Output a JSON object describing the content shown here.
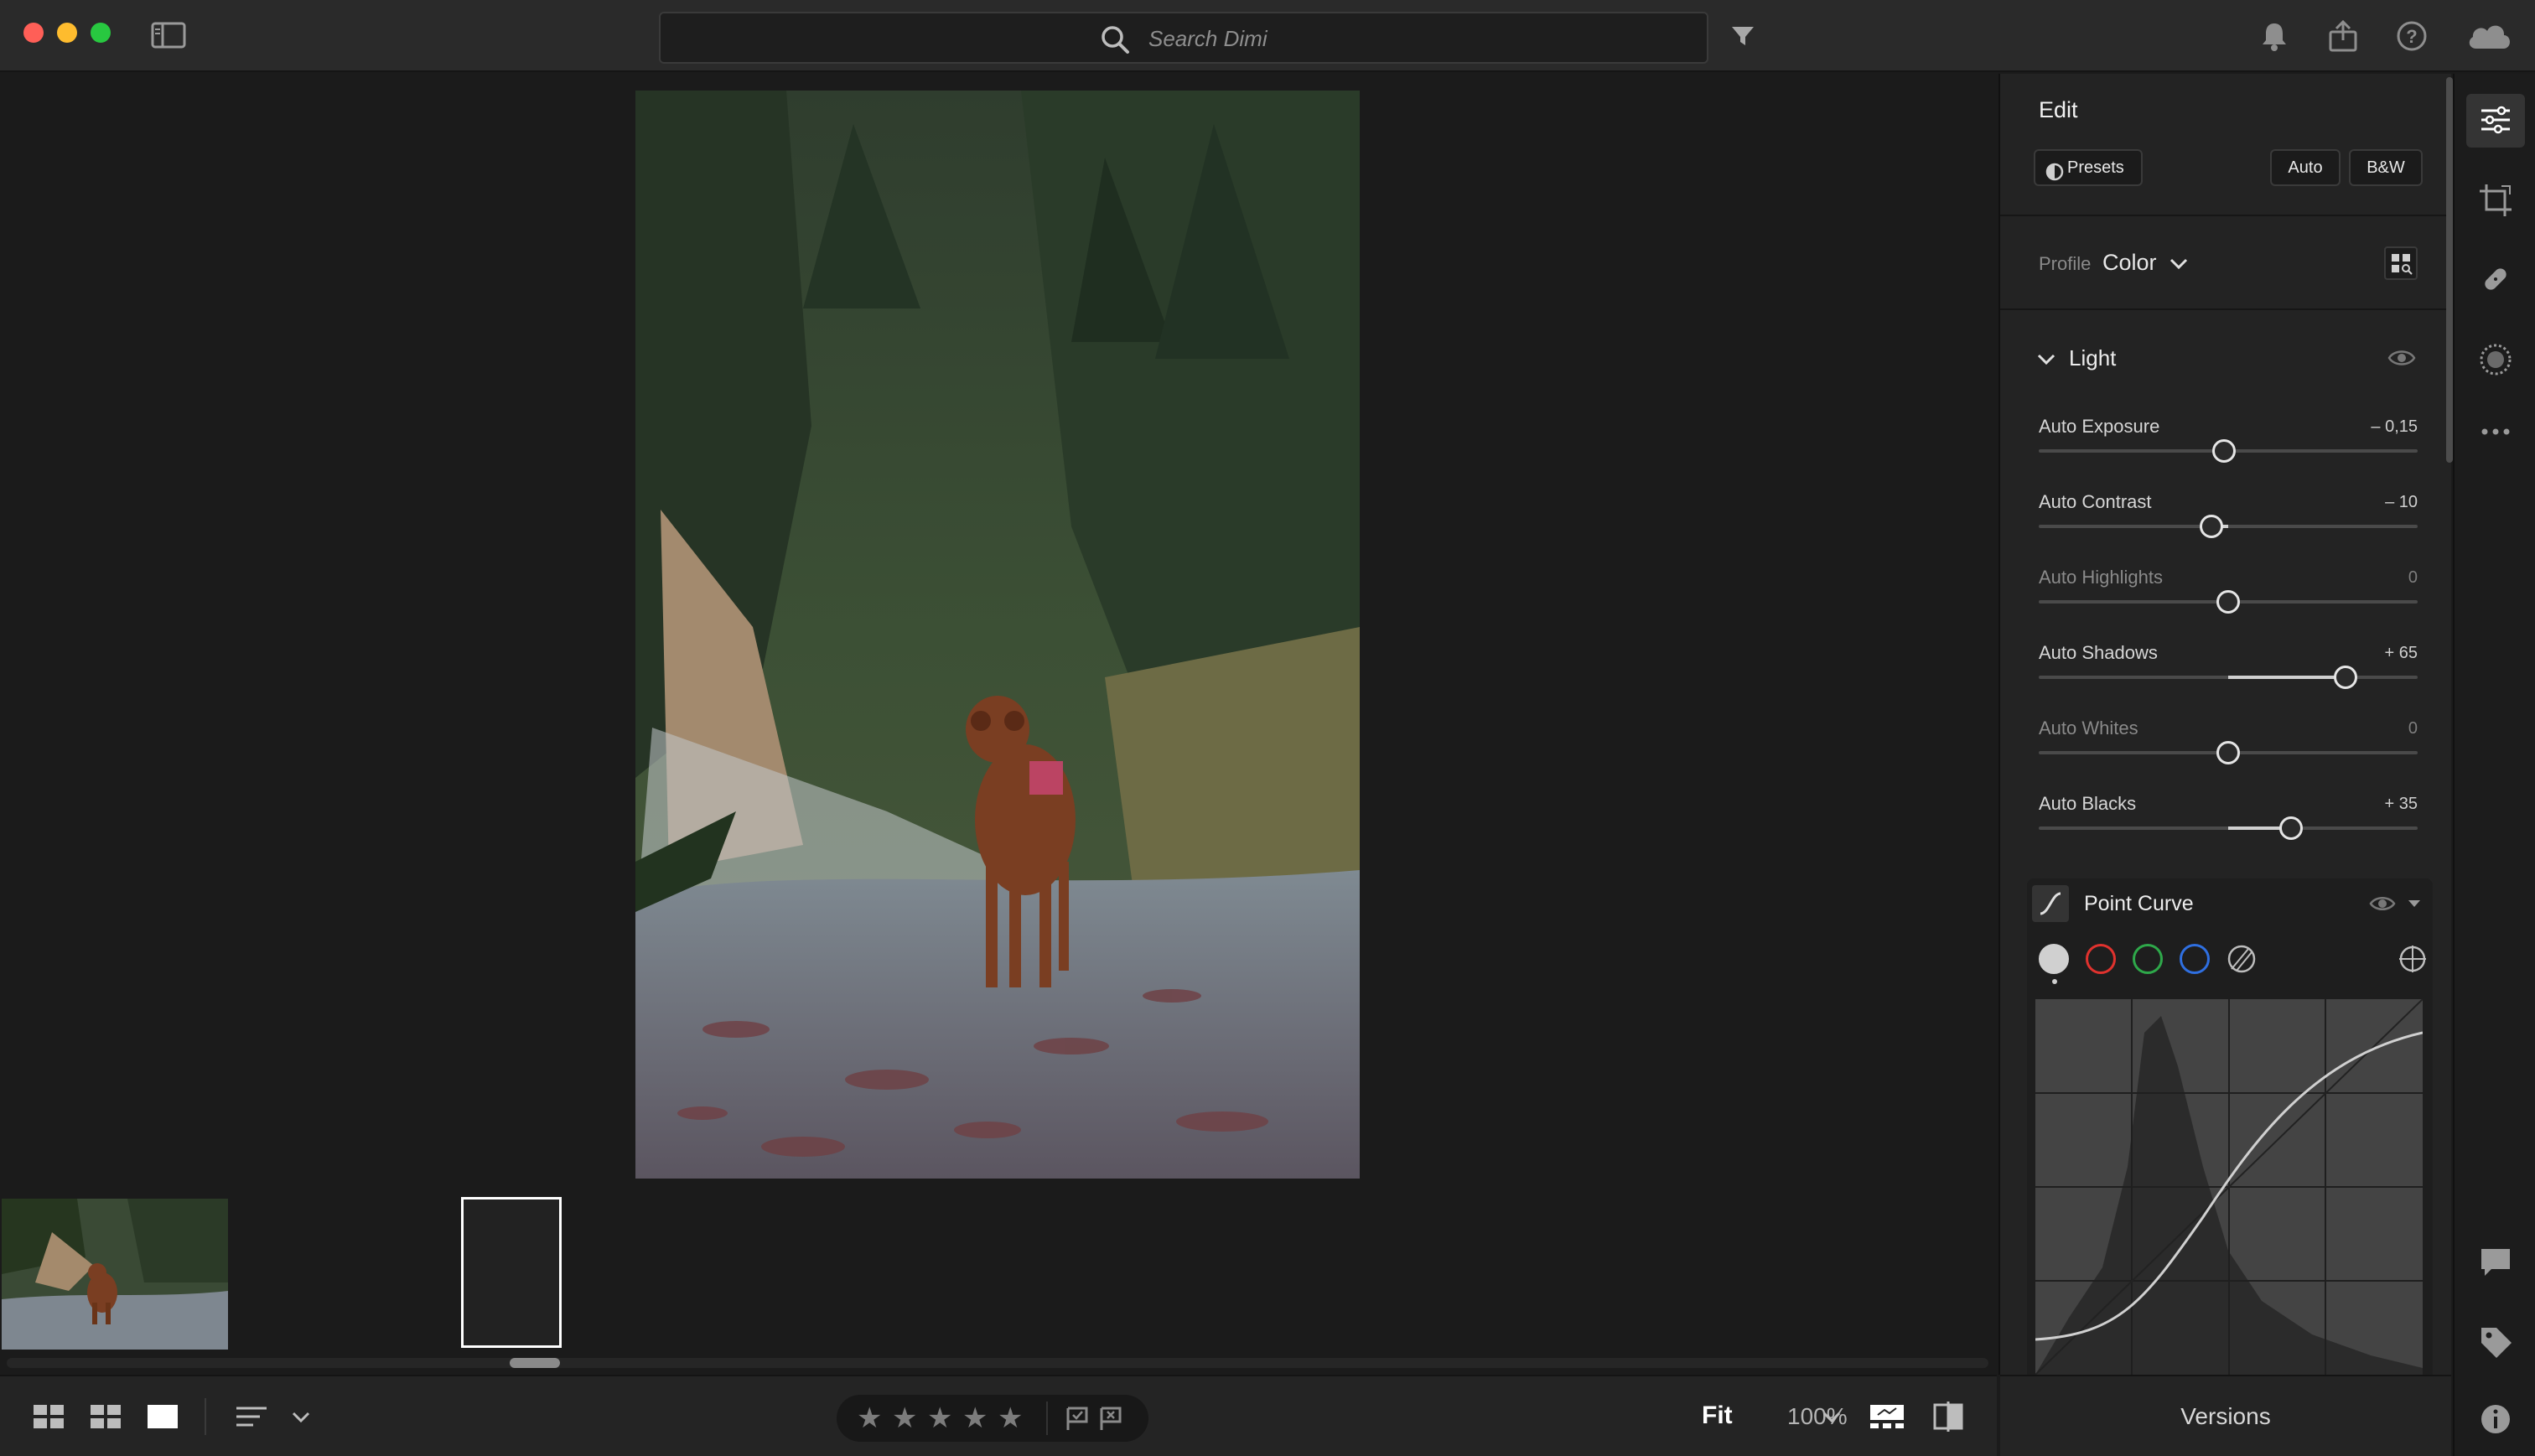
{
  "window": {
    "traffic_lights": {
      "close": "#ff5f57",
      "minimize": "#febc2e",
      "maximize": "#28c840"
    }
  },
  "search": {
    "placeholder": "Search Dimi"
  },
  "icons": {
    "sidebar_toggle": "sidebar-toggle-icon",
    "search": "search-icon",
    "filter": "filter-icon",
    "notifications": "bell-icon",
    "share": "share-icon",
    "help": "help-icon",
    "cloud": "cloud-icon"
  },
  "bottom_toolbar": {
    "rating_stars": 5,
    "fit_label": "Fit",
    "zoom_label": "100%"
  },
  "edit_panel": {
    "title": "Edit",
    "presets_label": "Presets",
    "auto_label": "Auto",
    "bw_label": "B&W",
    "profile_label": "Profile",
    "profile_value": "Color",
    "light": {
      "title": "Light",
      "sliders": [
        {
          "label": "Auto Exposure",
          "value": "– 0,15",
          "position": 0.49,
          "active": true
        },
        {
          "label": "Auto Contrast",
          "value": "– 10",
          "position": 0.455,
          "active": true
        },
        {
          "label": "Auto Highlights",
          "value": "0",
          "position": 0.5,
          "active": false
        },
        {
          "label": "Auto Shadows",
          "value": "+ 65",
          "position": 0.81,
          "active": true
        },
        {
          "label": "Auto Whites",
          "value": "0",
          "position": 0.5,
          "active": false
        },
        {
          "label": "Auto Blacks",
          "value": "+ 35",
          "position": 0.665,
          "active": true
        }
      ]
    },
    "point_curve": {
      "title": "Point Curve",
      "channels": [
        {
          "name": "rgb",
          "color": "#d0d0d0"
        },
        {
          "name": "red",
          "color": "#e0322e"
        },
        {
          "name": "green",
          "color": "#2ea84a"
        },
        {
          "name": "blue",
          "color": "#2f6fe0"
        }
      ]
    }
  },
  "versions_label": "Versions",
  "colors": {
    "accent": "#e5e5e5",
    "panel_bg": "#232323",
    "canvas_bg": "#1b1b1b"
  }
}
